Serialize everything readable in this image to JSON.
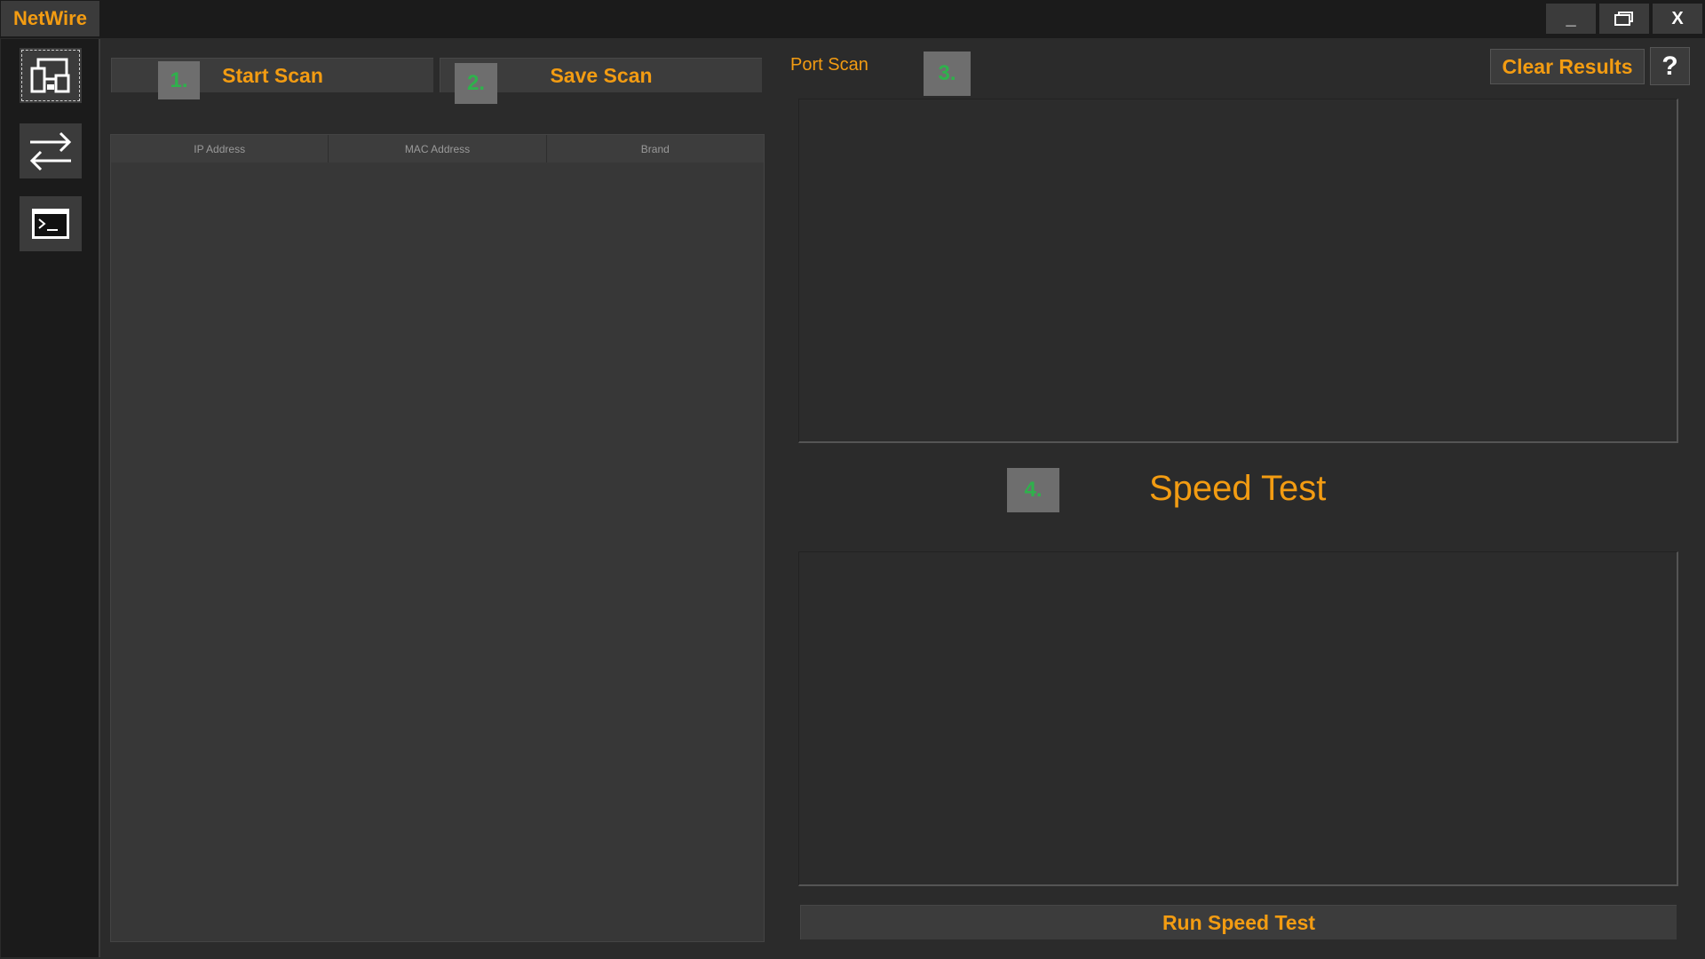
{
  "app": {
    "title": "NetWire"
  },
  "window_controls": {
    "minimize": "_",
    "restore": "❐",
    "close": "X"
  },
  "sidebar": {
    "items": [
      {
        "name": "devices-icon",
        "active": true
      },
      {
        "name": "transfer-icon",
        "active": false
      },
      {
        "name": "terminal-icon",
        "active": false
      }
    ]
  },
  "toolbar": {
    "start_scan_label": "Start Scan",
    "save_scan_label": "Save Scan",
    "step1": "1.",
    "step2": "2.",
    "step3": "3.",
    "step4": "4."
  },
  "table": {
    "columns": [
      "IP Address",
      "MAC Address",
      "Brand"
    ],
    "rows": []
  },
  "port_scan": {
    "label": "Port Scan"
  },
  "results": {
    "clear_label": "Clear Results",
    "help_label": "?"
  },
  "speed_test": {
    "title": "Speed Test",
    "run_label": "Run Speed Test"
  },
  "colors": {
    "accent": "#f39c12",
    "step": "#2fb14c",
    "bg": "#2b2b2b"
  }
}
